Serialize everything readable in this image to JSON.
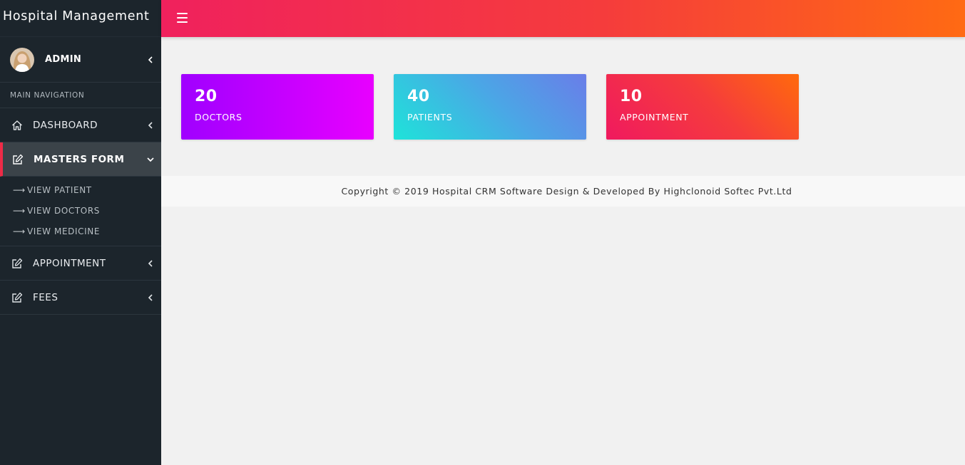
{
  "brand": {
    "title": "Hospital Management"
  },
  "user": {
    "name": "ADMIN"
  },
  "sidebar": {
    "header": "MAIN NAVIGATION",
    "items": [
      {
        "label": "DASHBOARD",
        "icon": "home-icon"
      },
      {
        "label": "MASTERS FORM",
        "icon": "edit-icon",
        "active": true,
        "children": [
          {
            "label": "VIEW PATIENT"
          },
          {
            "label": "VIEW DOCTORS"
          },
          {
            "label": "VIEW MEDICINE"
          }
        ]
      },
      {
        "label": "APPOINTMENT",
        "icon": "edit-icon"
      },
      {
        "label": "FEES",
        "icon": "edit-icon"
      }
    ]
  },
  "cards": [
    {
      "value": "20",
      "label": "DOCTORS"
    },
    {
      "value": "40",
      "label": "PATIENTS"
    },
    {
      "value": "10",
      "label": "APPOINTMENT"
    }
  ],
  "footer": {
    "text": "Copyright © 2019 Hospital CRM Software Design & Developed By Highclonoid Softec Pvt.Ltd"
  },
  "colors": {
    "sidebar_bg": "#1c252c",
    "topbar_start": "#f0215d",
    "topbar_end": "#ff6a13",
    "active_accent": "#ee2b47",
    "doctors_start": "#a000ff",
    "doctors_end": "#e800ff",
    "patients_start": "#1ee3d9",
    "patients_end": "#6a7de8",
    "appointment_start": "#f0195f",
    "appointment_end": "#ff6a0c"
  }
}
